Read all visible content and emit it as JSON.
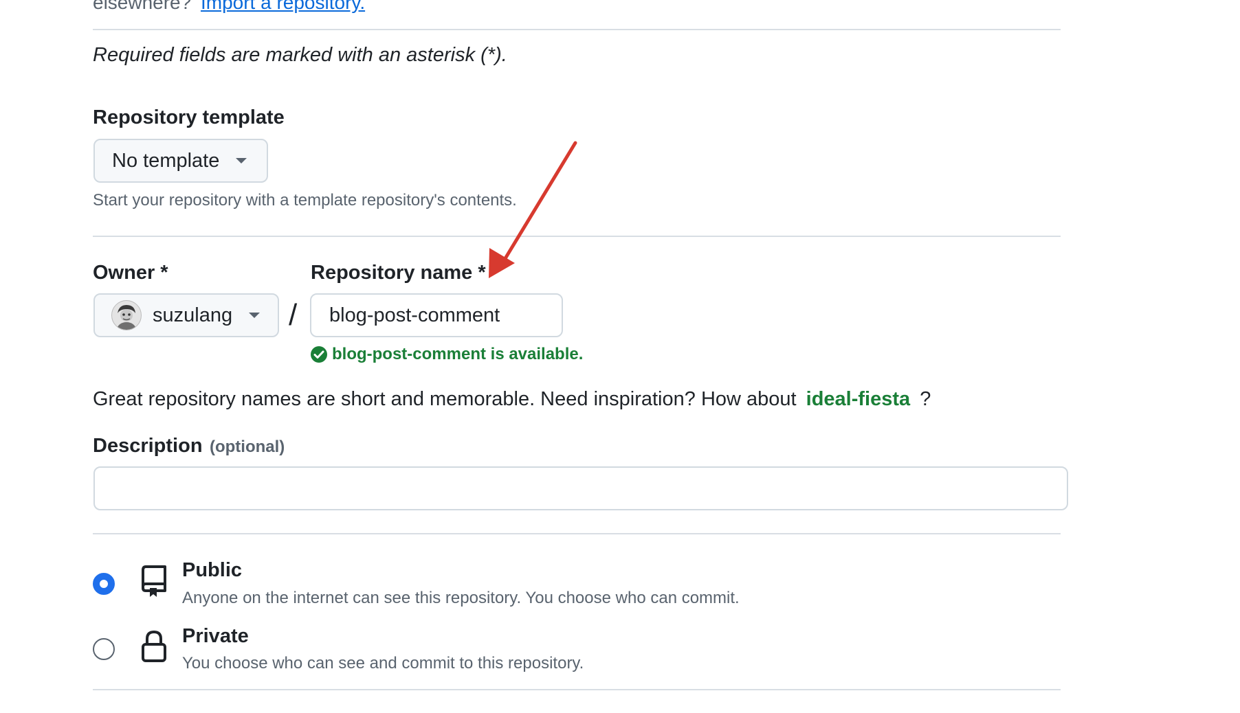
{
  "import_line": {
    "prefix": "elsewhere?",
    "link": "Import a repository."
  },
  "required_note": "Required fields are marked with an asterisk (*).",
  "template": {
    "label": "Repository template",
    "selected": "No template",
    "help": "Start your repository with a template repository's contents."
  },
  "owner": {
    "label": "Owner *",
    "selected": "suzulang"
  },
  "separator": "/",
  "repo_name": {
    "label": "Repository name *",
    "value": "blog-post-comment",
    "status": "blog-post-comment is available."
  },
  "inspiration": {
    "text": "Great repository names are short and memorable. Need inspiration? How about",
    "suggestion": "ideal-fiesta",
    "suffix": "?"
  },
  "description": {
    "label": "Description",
    "optional": "(optional)",
    "value": ""
  },
  "visibility": [
    {
      "title": "Public",
      "desc": "Anyone on the internet can see this repository. You choose who can commit.",
      "checked": true,
      "icon": "repo-icon"
    },
    {
      "title": "Private",
      "desc": "You choose who can see and commit to this repository.",
      "checked": false,
      "icon": "lock-icon"
    }
  ],
  "colors": {
    "link": "#0969da",
    "success": "#1a7f37",
    "radio": "#1f6feb",
    "annotation_arrow": "#d73a2f"
  }
}
